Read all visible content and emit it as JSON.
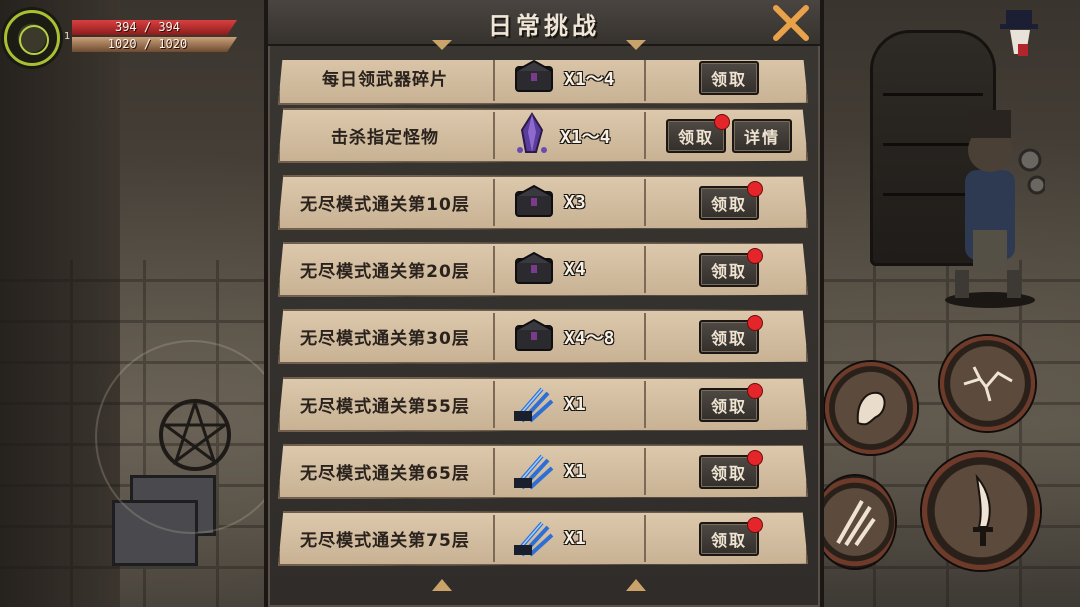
{
  "hud": {
    "level": "1",
    "hp_text": "394 / 394",
    "mp_text": "1020 / 1020",
    "hp_fraction": 1.0,
    "mp_fraction": 1.0
  },
  "panel": {
    "title": "日常挑战",
    "close_icon": "close-x-icon",
    "rows": [
      {
        "name": "每日领武器碎片",
        "qty": "X1～4",
        "icon": "dark-chest-icon",
        "claim": "领取",
        "detail": null,
        "badge": false
      },
      {
        "name": "击杀指定怪物",
        "qty": "X1～4",
        "icon": "purple-crystal-icon",
        "claim": "领取",
        "detail": "详情",
        "badge": true
      },
      {
        "name": "无尽模式通关第10层",
        "qty": "X3",
        "icon": "dark-chest-icon",
        "claim": "领取",
        "detail": null,
        "badge": true
      },
      {
        "name": "无尽模式通关第20层",
        "qty": "X4",
        "icon": "dark-chest-icon",
        "claim": "领取",
        "detail": null,
        "badge": true
      },
      {
        "name": "无尽模式通关第30层",
        "qty": "X4～8",
        "icon": "dark-chest-icon",
        "claim": "领取",
        "detail": null,
        "badge": true
      },
      {
        "name": "无尽模式通关第55层",
        "qty": "X1",
        "icon": "blue-claw-icon",
        "claim": "领取",
        "detail": null,
        "badge": true
      },
      {
        "name": "无尽模式通关第65层",
        "qty": "X1",
        "icon": "blue-claw-icon",
        "claim": "领取",
        "detail": null,
        "badge": true
      },
      {
        "name": "无尽模式通关第75层",
        "qty": "X1",
        "icon": "blue-claw-icon",
        "claim": "领取",
        "detail": null,
        "badge": true
      }
    ]
  },
  "colors": {
    "badge": "#e4252a",
    "hp": "#d84040",
    "accent": "#a8c032"
  }
}
